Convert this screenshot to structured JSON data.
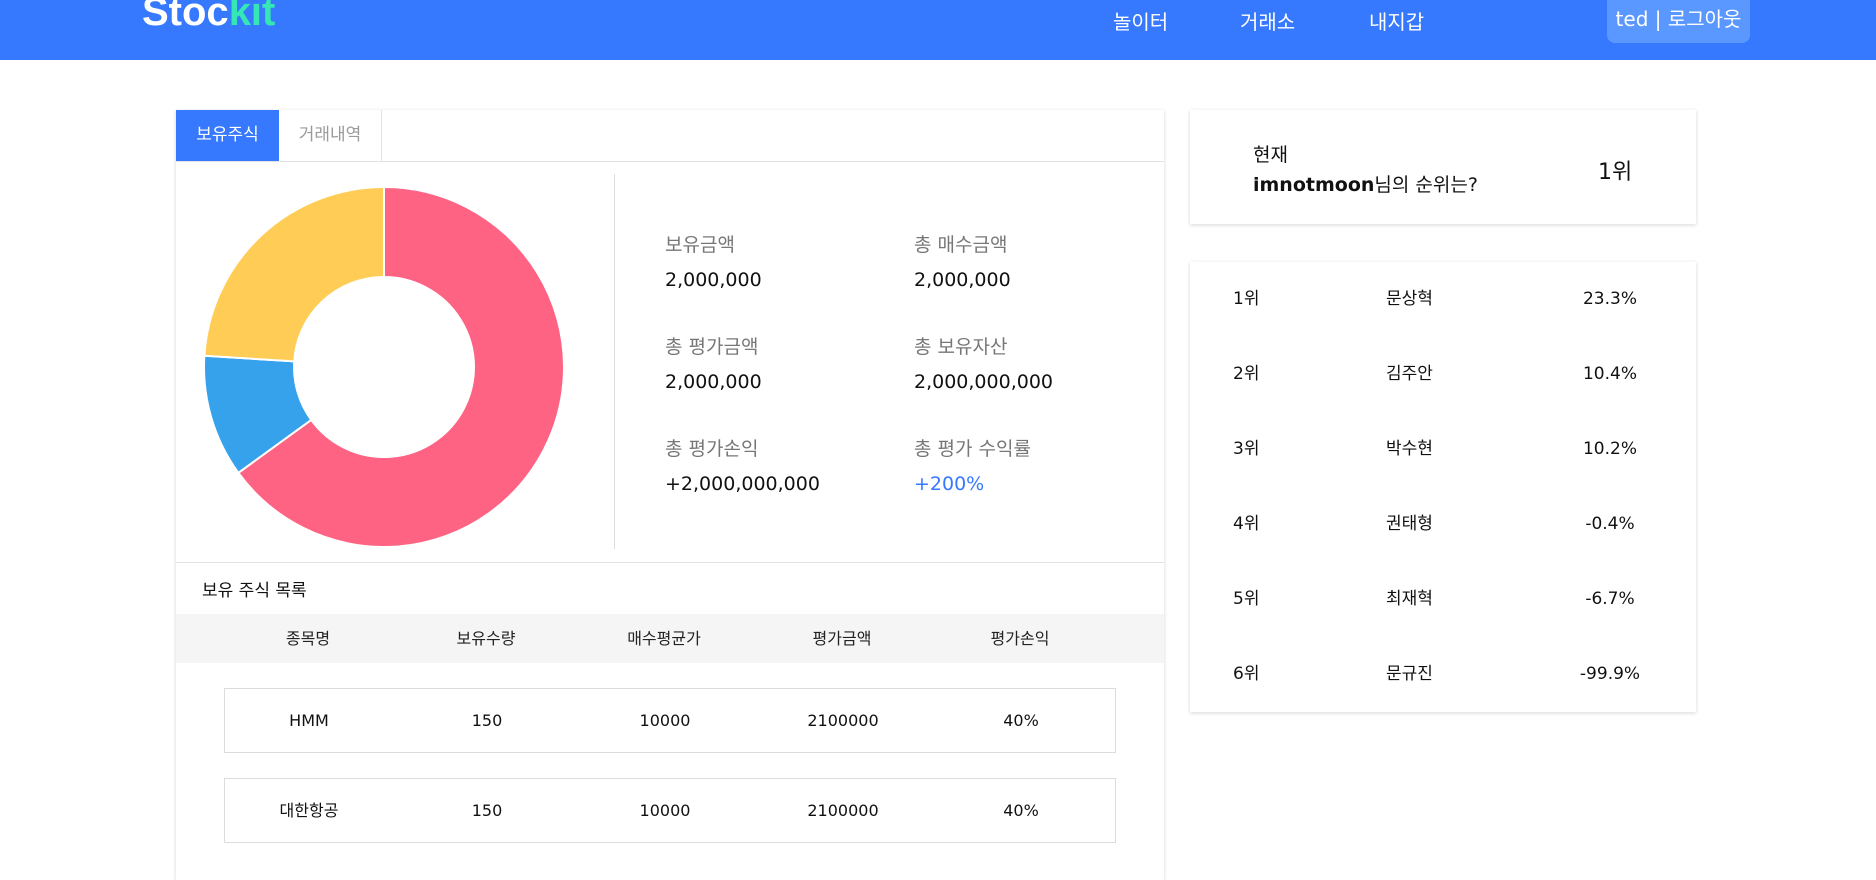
{
  "header": {
    "logo_main": "Stoc",
    "logo_accent": "kit",
    "nav": [
      "놀이터",
      "거래소",
      "내지갑"
    ],
    "user_label": "ted | 로그아웃",
    "accent_color": "#3679fe"
  },
  "portfolio": {
    "tabs": [
      "보유주식",
      "거래내역"
    ],
    "chart_data": {
      "type": "pie",
      "slices": [
        {
          "value": 65,
          "color": "#ff6384"
        },
        {
          "value": 11,
          "color": "#36a2eb"
        },
        {
          "value": 24,
          "color": "#ffcd56"
        }
      ]
    },
    "stats": [
      {
        "label": "보유금액",
        "value": "2,000,000"
      },
      {
        "label": "총 매수금액",
        "value": "2,000,000"
      },
      {
        "label": "총 평가금액",
        "value": "2,000,000"
      },
      {
        "label": "총 보유자산",
        "value": "2,000,000,000"
      },
      {
        "label": "총 평가손익",
        "value": "+2,000,000,000"
      },
      {
        "label": "총 평가 수익률",
        "value": "+200%"
      }
    ],
    "list_title": "보유 주식 목록",
    "columns": [
      "종목명",
      "보유수량",
      "매수평균가",
      "평가금액",
      "평가손익"
    ],
    "rows": [
      [
        "HMM",
        "150",
        "10000",
        "2100000",
        "40%"
      ],
      [
        "대한항공",
        "150",
        "10000",
        "2100000",
        "40%"
      ]
    ]
  },
  "rank": {
    "line1": "현재",
    "username": "imnotmoon",
    "suffix": "님의 순위는?",
    "value": "1위"
  },
  "leaderboard": [
    {
      "rank": "1위",
      "name": "문상혁",
      "pct": "23.3%"
    },
    {
      "rank": "2위",
      "name": "김주안",
      "pct": "10.4%"
    },
    {
      "rank": "3위",
      "name": "박수현",
      "pct": "10.2%"
    },
    {
      "rank": "4위",
      "name": "권태형",
      "pct": "-0.4%"
    },
    {
      "rank": "5위",
      "name": "최재혁",
      "pct": "-6.7%"
    },
    {
      "rank": "6위",
      "name": "문규진",
      "pct": "-99.9%"
    }
  ]
}
